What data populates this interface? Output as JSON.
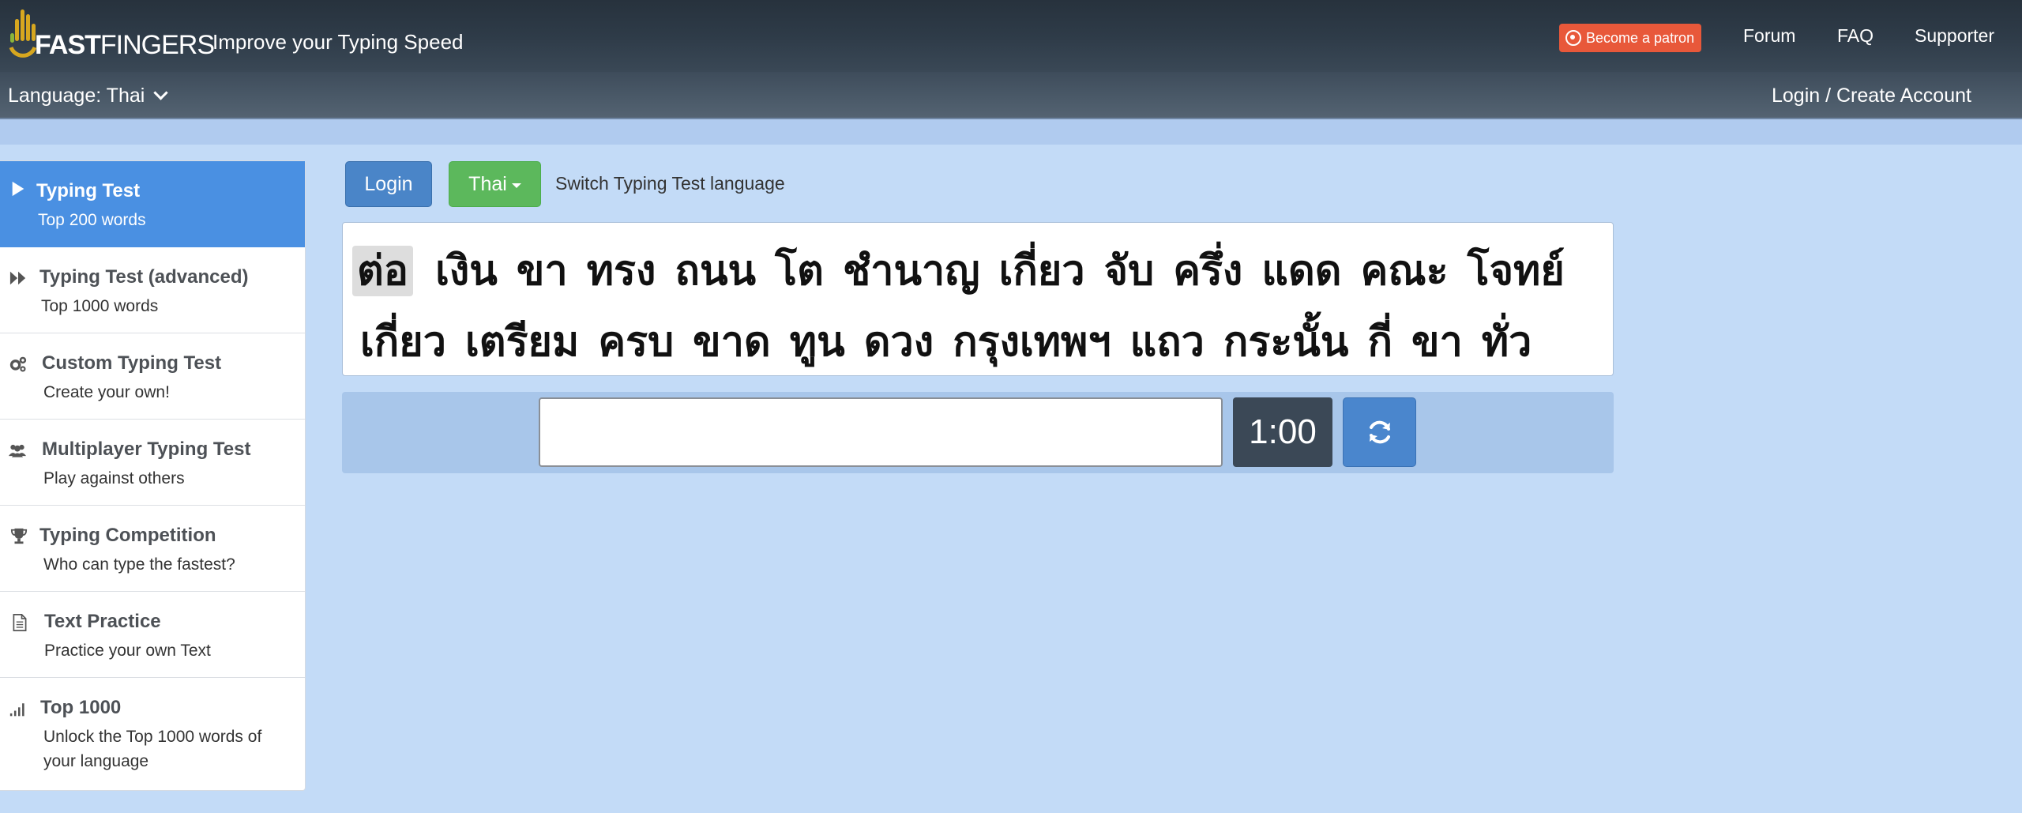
{
  "header": {
    "logo_bold": "FAST",
    "logo_light": "FINGERS",
    "tagline": "Improve your Typing Speed",
    "patron_button": "Become a patron",
    "nav": [
      "Forum",
      "FAQ",
      "Supporter"
    ]
  },
  "langbar": {
    "language_label": "Language: Thai",
    "login_link": "Login / Create Account"
  },
  "sidebar": {
    "items": [
      {
        "title": "Typing Test",
        "subtitle": "Top 200 words",
        "icon": "play-icon",
        "active": true
      },
      {
        "title": "Typing Test (advanced)",
        "subtitle": "Top 1000 words",
        "icon": "fast-forward-icon"
      },
      {
        "title": "Custom Typing Test",
        "subtitle": "Create your own!",
        "icon": "gears-icon"
      },
      {
        "title": "Multiplayer Typing Test",
        "subtitle": "Play against others",
        "icon": "users-icon"
      },
      {
        "title": "Typing Competition",
        "subtitle": "Who can type the fastest?",
        "icon": "trophy-icon"
      },
      {
        "title": "Text Practice",
        "subtitle": "Practice your own Text",
        "icon": "document-icon"
      },
      {
        "title": "Top 1000",
        "subtitle": "Unlock the Top 1000 words of",
        "subtitle2": "your language",
        "icon": "signal-bars-icon"
      }
    ]
  },
  "main": {
    "login_button": "Login",
    "language_button": "Thai",
    "switch_label": "Switch Typing Test language",
    "current_word": "ต่อ",
    "line1_rest": "เงิน ขา ทรง ถนน โต ชำนาญ เกี่ยว จับ ครึ่ง แดด คณะ โจทย์",
    "line2": "เกี่ยว เตรียม ครบ ขาด ทูน ดวง กรุงเทพฯ แถว กระนั้น กี่ ขา ทั่ว",
    "input_value": "",
    "timer": "1:00"
  },
  "colors": {
    "accent": "#4a90e2",
    "success": "#5cb85c",
    "patron": "#e8583a",
    "page_background": "#c3dbf7"
  }
}
